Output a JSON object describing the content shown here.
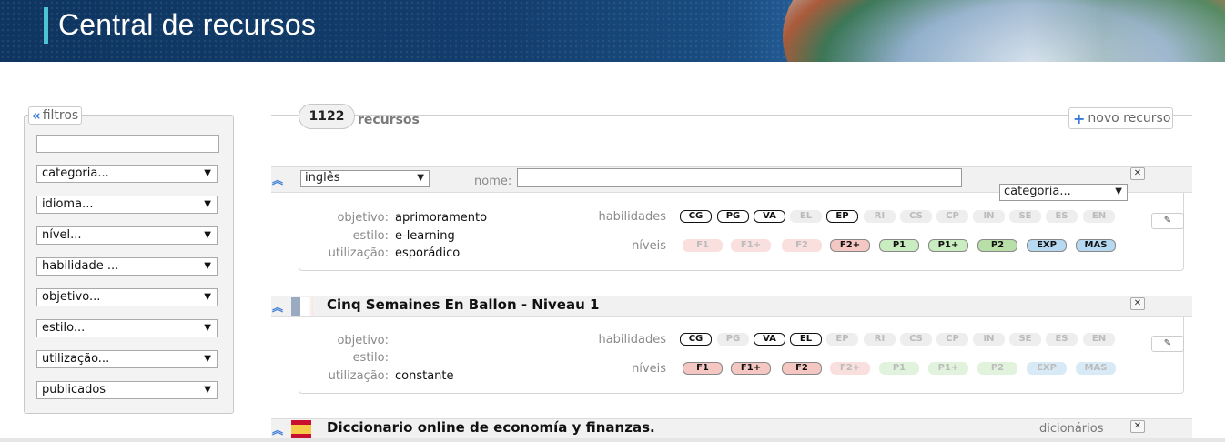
{
  "header": {
    "title": "Central de recursos"
  },
  "filters": {
    "legend": "filtros",
    "search_value": "",
    "selects": [
      "categoria...",
      "idioma...",
      "nível...",
      "habilidade ...",
      "objetivo...",
      "estilo...",
      "utilização...",
      "publicados"
    ]
  },
  "toolbar": {
    "count": "1122",
    "count_label": "recursos",
    "new_label": "novo recurso"
  },
  "editor": {
    "language": "inglês",
    "name_label": "nome:",
    "name_value": "",
    "category": "categoria..."
  },
  "labels": {
    "objetivo": "objetivo:",
    "estilo": "estilo:",
    "utilizacao": "utilização:",
    "habilidades": "habilidades",
    "niveis": "níveis"
  },
  "habilidades_codes": [
    "CG",
    "PG",
    "VA",
    "EL",
    "EP",
    "RI",
    "CS",
    "CP",
    "IN",
    "SE",
    "ES",
    "EN"
  ],
  "niveis_codes": [
    "F1",
    "F1+",
    "F2",
    "F2+",
    "P1",
    "P1+",
    "P2",
    "EXP",
    "MAS"
  ],
  "resources": [
    {
      "title": "",
      "category": "",
      "objetivo": "aprimoramento",
      "estilo": "e-learning",
      "utilizacao": "esporádico",
      "habilidades_on": [
        "CG",
        "PG",
        "VA",
        "EP"
      ],
      "niveis_on": [
        "F2+",
        "P1",
        "P1+",
        "P2",
        "EXP",
        "MAS"
      ]
    },
    {
      "title": "Cinq Semaines En Ballon - Niveau 1",
      "category": "",
      "objetivo": "",
      "estilo": "",
      "utilizacao": "constante",
      "habilidades_on": [
        "CG",
        "VA",
        "EL"
      ],
      "niveis_on": [
        "F1",
        "F1+",
        "F2"
      ]
    },
    {
      "title": "Diccionario online de economía y finanzas.",
      "category": "dicionários"
    }
  ],
  "icons": {
    "collapse": "chevron-double-up-icon",
    "close": "close-icon",
    "edit": "pencil-icon",
    "add": "plus-icon",
    "back": "chevron-double-left-icon"
  },
  "colors": {
    "F": "#f4c7c3",
    "F_off": "#f9e0de",
    "P": "#c9ecc0",
    "P2": "#b9dfa9",
    "P_off": "#e2f3dd",
    "E": "#b7d8f1",
    "E_off": "#d9eaf7",
    "accent": "#3a7bd5",
    "header_bar": "#4ec3d6"
  }
}
